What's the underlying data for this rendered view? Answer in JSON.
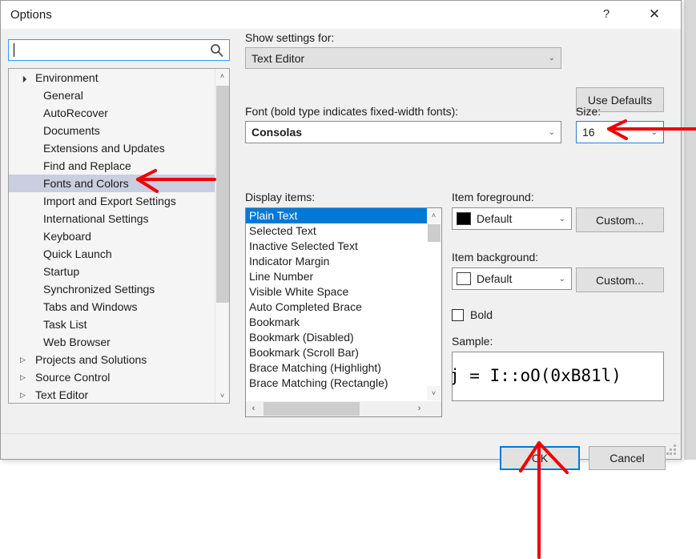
{
  "window": {
    "title": "Options",
    "help_button": "?",
    "close_button": "✕"
  },
  "search": {
    "value": "",
    "placeholder": "",
    "icon": "search-icon"
  },
  "tree": {
    "items": [
      {
        "label": "Environment",
        "level": 0,
        "expander": "▲",
        "expanded": true,
        "selected": false
      },
      {
        "label": "General",
        "level": 1,
        "expander": "",
        "selected": false
      },
      {
        "label": "AutoRecover",
        "level": 1,
        "expander": "",
        "selected": false
      },
      {
        "label": "Documents",
        "level": 1,
        "expander": "",
        "selected": false
      },
      {
        "label": "Extensions and Updates",
        "level": 1,
        "expander": "",
        "selected": false
      },
      {
        "label": "Find and Replace",
        "level": 1,
        "expander": "",
        "selected": false
      },
      {
        "label": "Fonts and Colors",
        "level": 1,
        "expander": "",
        "selected": true
      },
      {
        "label": "Import and Export Settings",
        "level": 1,
        "expander": "",
        "selected": false
      },
      {
        "label": "International Settings",
        "level": 1,
        "expander": "",
        "selected": false
      },
      {
        "label": "Keyboard",
        "level": 1,
        "expander": "",
        "selected": false
      },
      {
        "label": "Quick Launch",
        "level": 1,
        "expander": "",
        "selected": false
      },
      {
        "label": "Startup",
        "level": 1,
        "expander": "",
        "selected": false
      },
      {
        "label": "Synchronized Settings",
        "level": 1,
        "expander": "",
        "selected": false
      },
      {
        "label": "Tabs and Windows",
        "level": 1,
        "expander": "",
        "selected": false
      },
      {
        "label": "Task List",
        "level": 1,
        "expander": "",
        "selected": false
      },
      {
        "label": "Web Browser",
        "level": 1,
        "expander": "",
        "selected": false
      },
      {
        "label": "Projects and Solutions",
        "level": 0,
        "expander": "▷",
        "expanded": false,
        "selected": false
      },
      {
        "label": "Source Control",
        "level": 0,
        "expander": "▷",
        "expanded": false,
        "selected": false
      },
      {
        "label": "Text Editor",
        "level": 0,
        "expander": "▷",
        "expanded": false,
        "selected": false
      }
    ],
    "scroll_up_icon": "˄",
    "scroll_down_icon": "˅"
  },
  "settings": {
    "show_settings_for_label": "Show settings for:",
    "show_settings_for_value": "Text Editor",
    "use_defaults_label": "Use Defaults",
    "font_label": "Font (bold type indicates fixed-width fonts):",
    "font_value": "Consolas",
    "size_label": "Size:",
    "size_value": "16",
    "chevron": "⌄"
  },
  "display_items": {
    "label": "Display items:",
    "items": [
      "Plain Text",
      "Selected Text",
      "Inactive Selected Text",
      "Indicator Margin",
      "Line Number",
      "Visible White Space",
      "Auto Completed Brace",
      "Bookmark",
      "Bookmark (Disabled)",
      "Bookmark (Scroll Bar)",
      "Brace Matching (Highlight)",
      "Brace Matching (Rectangle)"
    ],
    "selected_index": 0,
    "selected_bg": "#0078d7",
    "selected_fg": "#ffffff",
    "hscroll_left_icon": "‹",
    "hscroll_right_icon": "›",
    "vscroll_up_icon": "˄",
    "vscroll_down_icon": "˅"
  },
  "item_foreground": {
    "label": "Item foreground:",
    "value": "Default",
    "swatch_color": "#000000",
    "custom_label": "Custom..."
  },
  "item_background": {
    "label": "Item background:",
    "value": "Default",
    "swatch_color": "#ffffff",
    "custom_label": "Custom..."
  },
  "bold": {
    "label": "Bold",
    "checked": false
  },
  "sample": {
    "label": "Sample:",
    "text": "j = I::oO(0xB81l)"
  },
  "footer": {
    "ok_label": "OK",
    "cancel_label": "Cancel"
  },
  "annotations": {
    "color": "#ee0000",
    "arrows": [
      "arrow-to-fonts-and-colors",
      "arrow-to-size-field",
      "arrow-to-ok-button"
    ]
  }
}
